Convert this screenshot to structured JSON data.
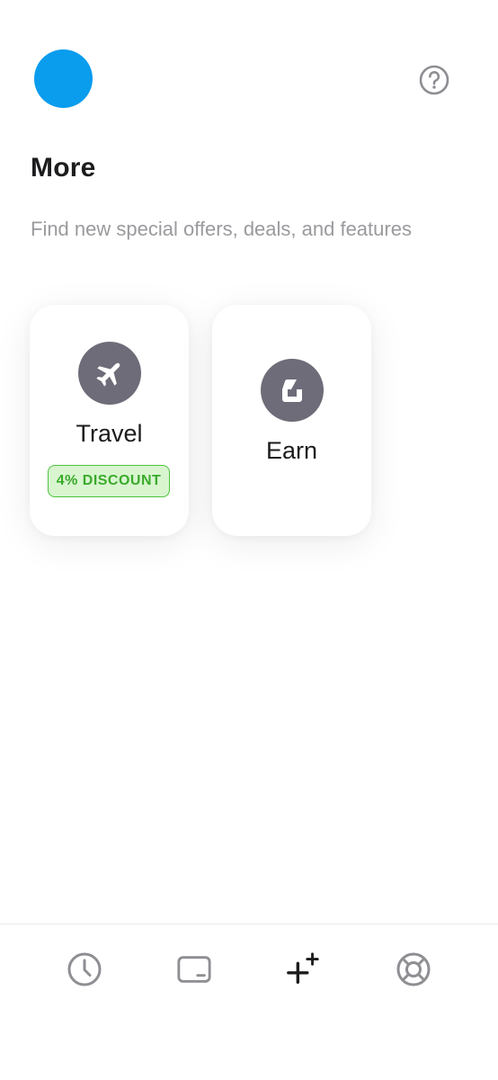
{
  "header": {
    "avatar_color": "#0a9ced",
    "help_icon": "question-circle-icon"
  },
  "page": {
    "title": "More",
    "subtitle": "Find new special offers, deals, and features"
  },
  "cards": [
    {
      "label": "Travel",
      "icon": "airplane-icon",
      "badge": "4% DISCOUNT"
    },
    {
      "label": "Earn",
      "icon": "earn-icon"
    }
  ],
  "tabbar": {
    "items": [
      {
        "icon": "clock-icon",
        "active": false
      },
      {
        "icon": "card-icon",
        "active": false
      },
      {
        "icon": "sparkle-plus-icon",
        "active": true
      },
      {
        "icon": "lifebuoy-icon",
        "active": false
      }
    ]
  },
  "colors": {
    "accent": "#0a9ced",
    "icon_bg": "#6d6c78",
    "badge_green": "#3aaa2a",
    "badge_bg": "#d8f5d0"
  }
}
